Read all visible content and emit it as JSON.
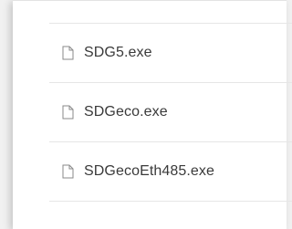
{
  "files": [
    {
      "name": "SDG5.exe",
      "icon": "file-icon"
    },
    {
      "name": "SDGeco.exe",
      "icon": "file-icon"
    },
    {
      "name": "SDGecoEth485.exe",
      "icon": "file-icon"
    }
  ],
  "colors": {
    "background": "#f1f1f1",
    "panel": "#ffffff",
    "text": "#3a3a3a",
    "divider": "#e6e6e6",
    "icon_stroke": "#8a8a8a"
  }
}
